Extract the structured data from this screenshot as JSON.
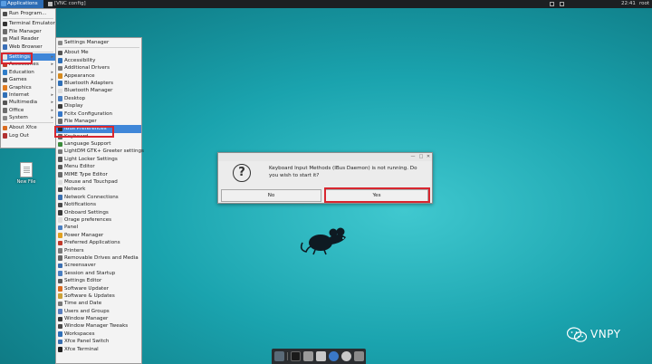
{
  "top_panel": {
    "apps_label": "Applications",
    "task_label": "[VNC config]",
    "clock": "22:41",
    "user": "root"
  },
  "app_menu": {
    "items": [
      {
        "label": "Run Program...",
        "icon": "run-icon",
        "color": "#4d4d4d"
      },
      {
        "label": "Terminal Emulator",
        "icon": "terminal-icon",
        "color": "#333333"
      },
      {
        "label": "File Manager",
        "icon": "folder-icon",
        "color": "#6b6b6b"
      },
      {
        "label": "Mail Reader",
        "icon": "mail-icon",
        "color": "#7c7c7c"
      },
      {
        "label": "Web Browser",
        "icon": "globe-icon",
        "color": "#3a6fb7"
      },
      {
        "label": "Settings",
        "icon": "gear-icon",
        "color": "#e4e4e4",
        "submenu": true
      },
      {
        "label": "Accessories",
        "icon": "accessories-icon",
        "color": "#c0392b",
        "submenu": true
      },
      {
        "label": "Education",
        "icon": "education-icon",
        "color": "#2f7dc9",
        "submenu": true
      },
      {
        "label": "Games",
        "icon": "games-icon",
        "color": "#5c5c5c",
        "submenu": true
      },
      {
        "label": "Graphics",
        "icon": "graphics-icon",
        "color": "#e07b1f",
        "submenu": true
      },
      {
        "label": "Internet",
        "icon": "internet-icon",
        "color": "#2f6fb6",
        "submenu": true
      },
      {
        "label": "Multimedia",
        "icon": "multimedia-icon",
        "color": "#555555",
        "submenu": true
      },
      {
        "label": "Office",
        "icon": "office-icon",
        "color": "#6d6d6d",
        "submenu": true
      },
      {
        "label": "System",
        "icon": "system-icon",
        "color": "#888888",
        "submenu": true
      },
      {
        "label": "About Xfce",
        "icon": "about-icon",
        "color": "#d96b1e"
      },
      {
        "label": "Log Out",
        "icon": "logout-icon",
        "color": "#b03030"
      }
    ]
  },
  "settings_menu": {
    "title": "Settings Manager",
    "items": [
      {
        "label": "About Me",
        "color": "#555555"
      },
      {
        "label": "Accessibility",
        "color": "#2f6fb6"
      },
      {
        "label": "Additional Drivers",
        "color": "#777777"
      },
      {
        "label": "Appearance",
        "color": "#d58a1e"
      },
      {
        "label": "Bluetooth Adapters",
        "color": "#2f6fb6"
      },
      {
        "label": "Bluetooth Manager",
        "color": "#dddddd"
      },
      {
        "label": "Desktop",
        "color": "#4a7fc1"
      },
      {
        "label": "Display",
        "color": "#3a3a3a"
      },
      {
        "label": "Fcitx Configuration",
        "color": "#3577c8"
      },
      {
        "label": "File Manager",
        "color": "#6b6b6b"
      },
      {
        "label": "IBus Preferences",
        "color": "#2b2b2b"
      },
      {
        "label": "Keyboard",
        "color": "#666666"
      },
      {
        "label": "Language Support",
        "color": "#3b8a3b"
      },
      {
        "label": "LightDM GTK+ Greeter settings",
        "color": "#777777"
      },
      {
        "label": "Light Locker Settings",
        "color": "#555555"
      },
      {
        "label": "Menu Editor",
        "color": "#5b5b5b"
      },
      {
        "label": "MIME Type Editor",
        "color": "#6a6a6a"
      },
      {
        "label": "Mouse and Touchpad",
        "color": "#dddddd"
      },
      {
        "label": "Network",
        "color": "#444444"
      },
      {
        "label": "Network Connections",
        "color": "#3b6fb0"
      },
      {
        "label": "Notifications",
        "color": "#4a4a4a"
      },
      {
        "label": "Onboard Settings",
        "color": "#3a3a3a"
      },
      {
        "label": "Orage preferences",
        "color": "#dddddd"
      },
      {
        "label": "Panel",
        "color": "#4a7fc1"
      },
      {
        "label": "Power Manager",
        "color": "#e0a020"
      },
      {
        "label": "Preferred Applications",
        "color": "#c0392b"
      },
      {
        "label": "Printers",
        "color": "#7a7a7a"
      },
      {
        "label": "Removable Drives and Media",
        "color": "#666666"
      },
      {
        "label": "Screensaver",
        "color": "#3a6fb0"
      },
      {
        "label": "Session and Startup",
        "color": "#4a7fc1"
      },
      {
        "label": "Settings Editor",
        "color": "#5b5b5b"
      },
      {
        "label": "Software Updater",
        "color": "#d96b1e"
      },
      {
        "label": "Software & Updates",
        "color": "#c9a23a"
      },
      {
        "label": "Time and Date",
        "color": "#777777"
      },
      {
        "label": "Users and Groups",
        "color": "#5a7fbf"
      },
      {
        "label": "Window Manager",
        "color": "#3a3a3a"
      },
      {
        "label": "Window Manager Tweaks",
        "color": "#4a4a4a"
      },
      {
        "label": "Workspaces",
        "color": "#2f6fb6"
      },
      {
        "label": "Xfce Panel Switch",
        "color": "#3a6fb0"
      },
      {
        "label": "Xfce Terminal",
        "color": "#222222"
      }
    ]
  },
  "desktop_icon": {
    "label": "New File",
    "icon": "document-icon"
  },
  "dialog": {
    "message": "Keyboard Input Methods (IBus Daemon) is not running. Do you wish to start it?",
    "no_label": "No",
    "yes_label": "Yes",
    "icon": "question-icon",
    "question_glyph": "?",
    "titlebar_buttons": [
      "—",
      "□",
      "✕"
    ]
  },
  "dock": {
    "items": [
      {
        "icon": "show-desktop-icon",
        "color": "#5a6a78"
      },
      {
        "icon": "terminal-icon",
        "color": "#1a1a1a"
      },
      {
        "icon": "file-manager-icon",
        "color": "#9a9a9a"
      },
      {
        "icon": "web-browser-icon",
        "color": "#3a78c8"
      },
      {
        "icon": "search-icon",
        "color": "#c8c8c8"
      },
      {
        "icon": "folder-icon",
        "color": "#8a8a8a"
      }
    ]
  },
  "watermark": {
    "text": "VNPY",
    "icon": "wechat-icon"
  },
  "colors": {
    "selection": "#3f86d8",
    "highlight": "#d8262f",
    "panel": "#1c1f22"
  }
}
